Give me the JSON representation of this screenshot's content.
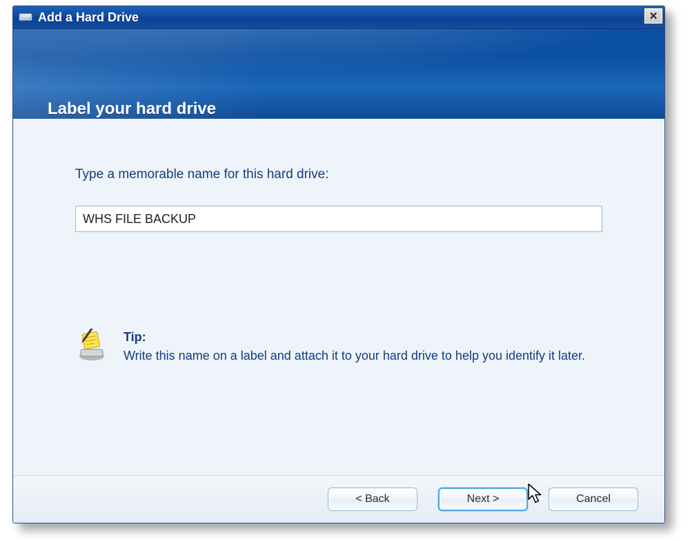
{
  "window": {
    "title": "Add a Hard Drive"
  },
  "header": {
    "title": "Label your hard drive"
  },
  "content": {
    "prompt": "Type a memorable name for this hard drive:",
    "drive_name_value": "WHS FILE BACKUP"
  },
  "tip": {
    "heading": "Tip:",
    "body": "Write this name on a label and attach it to your hard drive to help you identify it later."
  },
  "footer": {
    "back_label": "< Back",
    "next_label": "Next >",
    "cancel_label": "Cancel"
  }
}
